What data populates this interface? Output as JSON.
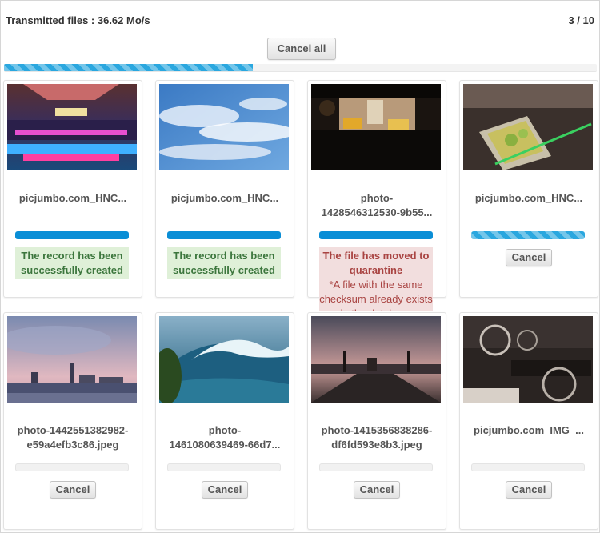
{
  "header": {
    "status": "Transmitted files : 36.62 Mo/s",
    "counter": "3 / 10",
    "cancel_all": "Cancel all",
    "global_progress": 0.42
  },
  "cards": [
    {
      "name": "picjumbo.com_HNC...",
      "progress": 1.0,
      "bar": "solid",
      "success": "The record has been successfully created",
      "image": "nightclub-icon"
    },
    {
      "name": "picjumbo.com_HNC...",
      "progress": 1.0,
      "bar": "solid",
      "success": "The record has been successfully created",
      "image": "sky-icon"
    },
    {
      "name_lines": [
        "photo-",
        "1428546312530-9b55..."
      ],
      "progress": 1.0,
      "bar": "solid",
      "error_title": "The file has moved to quarantine",
      "error_detail": "*A file with the same checksum already exists in the database",
      "image": "taxi-street-icon"
    },
    {
      "name": "picjumbo.com_HNC...",
      "progress": 1.0,
      "bar": "striped",
      "cancel": "Cancel",
      "image": "cocktail-icon"
    },
    {
      "name_lines": [
        "photo-1442551382982-",
        "e59a4efb3c86.jpeg"
      ],
      "progress": 0,
      "bar": "empty",
      "cancel": "Cancel",
      "image": "city-skyline-icon"
    },
    {
      "name_lines": [
        "photo-",
        "1461080639469-66d7..."
      ],
      "progress": 0,
      "bar": "empty",
      "cancel": "Cancel",
      "image": "wave-icon"
    },
    {
      "name_lines": [
        "photo-1415356838286-",
        "df6fd593e8b3.jpeg"
      ],
      "progress": 0,
      "bar": "empty",
      "cancel": "Cancel",
      "image": "bridge-dusk-icon"
    },
    {
      "name": "picjumbo.com_IMG_...",
      "progress": 0,
      "bar": "empty",
      "cancel": "Cancel",
      "image": "car-dashboard-icon"
    }
  ]
}
